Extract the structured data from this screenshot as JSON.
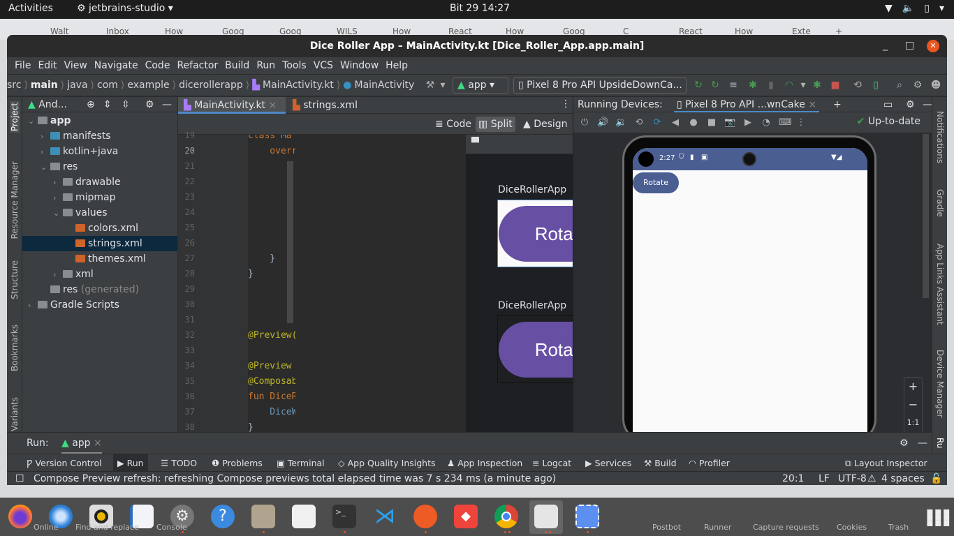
{
  "desktop": {
    "activities": "Activities",
    "app_name": "jetbrains-studio",
    "clock": "Bit 29  14:27",
    "browser_tabs": [
      "Walt",
      "Inbox",
      "How",
      "Goog",
      "Goog",
      "WILS",
      "How",
      "React",
      "How",
      "Goog",
      "C",
      "React",
      "How",
      "Exte",
      "+"
    ]
  },
  "window": {
    "title": "Dice Roller App – MainActivity.kt [Dice_Roller_App.app.main]",
    "minimize": "_",
    "maximize": "□",
    "close": "✕"
  },
  "menu": [
    "File",
    "Edit",
    "View",
    "Navigate",
    "Code",
    "Refactor",
    "Build",
    "Run",
    "Tools",
    "VCS",
    "Window",
    "Help"
  ],
  "breadcrumb": [
    "src",
    "main",
    "java",
    "com",
    "example",
    "dicerollerapp",
    "MainActivity.kt",
    "MainActivity"
  ],
  "run_config": {
    "module": "app",
    "device": "Pixel 8 Pro API UpsideDownCa..."
  },
  "left_stripe": [
    "Project",
    "Resource Manager",
    "Structure",
    "Bookmarks",
    "Build Variants"
  ],
  "project": {
    "header": "And...",
    "tree": [
      {
        "label": "app",
        "depth": 0,
        "expanded": true,
        "kind": "module"
      },
      {
        "label": "manifests",
        "depth": 1,
        "expanded": false,
        "kind": "folder"
      },
      {
        "label": "kotlin+java",
        "depth": 1,
        "expanded": false,
        "kind": "folder"
      },
      {
        "label": "res",
        "depth": 1,
        "expanded": true,
        "kind": "res"
      },
      {
        "label": "drawable",
        "depth": 2,
        "expanded": false,
        "kind": "pkg"
      },
      {
        "label": "mipmap",
        "depth": 2,
        "expanded": false,
        "kind": "pkg"
      },
      {
        "label": "values",
        "depth": 2,
        "expanded": true,
        "kind": "pkg"
      },
      {
        "label": "colors.xml",
        "depth": 3,
        "kind": "xml"
      },
      {
        "label": "strings.xml",
        "depth": 3,
        "kind": "xml",
        "selected": true
      },
      {
        "label": "themes.xml",
        "depth": 3,
        "kind": "xml"
      },
      {
        "label": "xml",
        "depth": 2,
        "expanded": false,
        "kind": "pkg"
      },
      {
        "label": "res",
        "suffix": "(generated)",
        "depth": 1,
        "kind": "res"
      },
      {
        "label": "Gradle Scripts",
        "depth": 0,
        "expanded": false,
        "kind": "gradle"
      }
    ]
  },
  "editor": {
    "tabs": [
      {
        "label": "MainActivity.kt",
        "active": true
      },
      {
        "label": "strings.xml",
        "active": false
      }
    ],
    "modes": [
      "Code",
      "Split",
      "Design"
    ],
    "selected_mode": "Split",
    "line_numbers": [
      "19",
      "20",
      "21",
      "22",
      "23",
      "24",
      "25",
      "26",
      "27",
      "28",
      "29",
      "30",
      "31",
      "32",
      "33",
      "34",
      "35",
      "36",
      "37",
      "38"
    ],
    "current_line": "20",
    "code_lines": [
      {
        "line": "19",
        "text": "class Ma"
      },
      {
        "line": "20",
        "text": "    overr"
      },
      {
        "line": "27",
        "text": "    }"
      },
      {
        "line": "28",
        "text": "}"
      },
      {
        "line": "32",
        "text": "@Preview("
      },
      {
        "line": "34",
        "text": "@Preview "
      },
      {
        "line": "35",
        "text": "@Composab"
      },
      {
        "line": "36",
        "text": "fun DiceR"
      },
      {
        "line": "37",
        "text": "    DiceW"
      },
      {
        "line": "38",
        "text": "}"
      }
    ]
  },
  "preview": {
    "status": "Up-to-date",
    "items": [
      {
        "label": "DiceRollerApp",
        "button": "Rotate",
        "theme": "light"
      },
      {
        "label": "DiceRollerApp",
        "button": "Rotate",
        "theme": "dark"
      }
    ],
    "button_color": "#6750a4"
  },
  "running_devices": {
    "label": "Running Devices:",
    "tab": "Pixel 8 Pro API ...wnCake",
    "status": "Up-to-date",
    "phone": {
      "time": "2:27",
      "button": "Rotate",
      "statusbar_color": "#4b5e92"
    },
    "zoom_controls": [
      "+",
      "−",
      "1:1",
      "⛶"
    ]
  },
  "right_stripe": [
    "Notifications",
    "Gradle",
    "App Links Assistant",
    "Device Manager",
    "Ru"
  ],
  "run_panel": {
    "label": "Run:",
    "tab": "app"
  },
  "tool_windows": [
    "Version Control",
    "Run",
    "TODO",
    "Problems",
    "Terminal",
    "App Quality Insights",
    "App Inspection",
    "Logcat",
    "Services",
    "Build",
    "Profiler"
  ],
  "layout_inspector": "Layout Inspector",
  "status": {
    "message": "Compose Preview refresh: refreshing Compose previews total elapsed time was 7 s 234 ms (a minute ago)",
    "position": "20:1",
    "line_sep": "LF",
    "encoding": "UTF-8",
    "indent": "4 spaces"
  },
  "dock": {
    "apps": [
      "Firefox",
      "Thunderbird",
      "Rhythmbox",
      "LibreOffice Writer",
      "Settings",
      "Help",
      "Files",
      "Document Viewer",
      "Terminal",
      "VS Code",
      "Postman",
      "AnyDesk",
      "Chrome",
      "Android Studio",
      "Screenshot"
    ],
    "postman_footer": [
      "Online",
      "Find and replace",
      "Console",
      "Postbot",
      "Runner",
      "Capture requests",
      "Cookies",
      "Trash"
    ]
  }
}
